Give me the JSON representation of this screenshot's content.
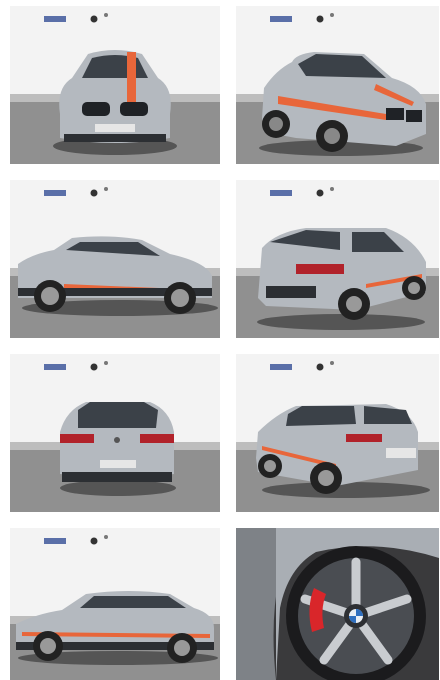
{
  "gallery": {
    "photos": [
      {
        "view": "front"
      },
      {
        "view": "front-three-quarter"
      },
      {
        "view": "side"
      },
      {
        "view": "rear-three-quarter"
      },
      {
        "view": "rear"
      },
      {
        "view": "rear-three-quarter-right"
      },
      {
        "view": "side-low"
      },
      {
        "view": "wheel-detail"
      }
    ]
  },
  "colors": {
    "body_paint": "#b4b9bf",
    "accent_stripe": "#e8663a",
    "studio_wall": "#f3f3f3",
    "studio_floor": "#8f8f8f",
    "brake_caliper": "#d9262a"
  }
}
